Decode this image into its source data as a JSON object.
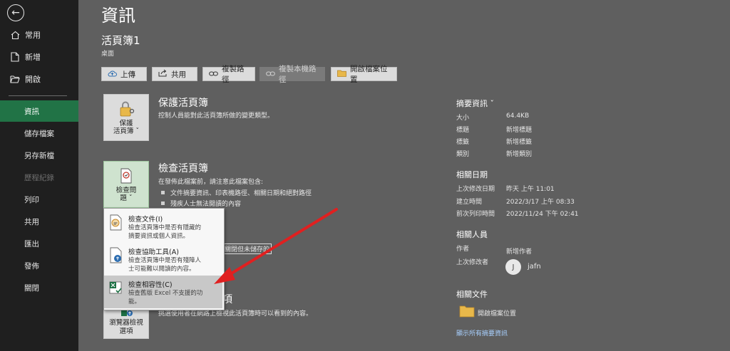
{
  "sidebar": {
    "back_icon": "back-arrow-icon",
    "top_items": [
      {
        "label": "常用",
        "icon": "home-icon"
      },
      {
        "label": "新增",
        "icon": "new-document-icon"
      },
      {
        "label": "開啟",
        "icon": "open-folder-icon"
      }
    ],
    "items": [
      {
        "label": "資訊"
      },
      {
        "label": "儲存檔案"
      },
      {
        "label": "另存新檔"
      },
      {
        "label": "歷程紀錄"
      },
      {
        "label": "列印"
      },
      {
        "label": "共用"
      },
      {
        "label": "匯出"
      },
      {
        "label": "發佈"
      },
      {
        "label": "關閉"
      }
    ]
  },
  "main": {
    "title": "資訊",
    "doc_name": "活頁簿1",
    "doc_location": "桌面",
    "toolbar": {
      "upload": "上傳",
      "share": "共用",
      "copy_path": "複製路徑",
      "copy_local_path": "複製本機路徑",
      "open_location": "開啟檔案位置"
    },
    "protect": {
      "tile_line1": "保護",
      "tile_line2": "活頁簿 ˇ",
      "title": "保護活頁簿",
      "desc": "控制人員能對此活頁簿所做的變更類型。"
    },
    "inspect": {
      "tile_line1": "檢查問",
      "tile_line2": "題 ˇ",
      "title": "檢查活頁簿",
      "desc": "在發佈此檔案前，請注意此檔案包含:",
      "bullets": [
        "文件摘要資訊、印表機路徑、相關日期和絕對路徑",
        "殘疾人士無法閱讀的內容"
      ],
      "partial_text": "關閉但未儲存的"
    },
    "browser": {
      "title_tail": "項",
      "tile_line1": "瀏覽器檢視",
      "tile_line2": "選項",
      "desc": "挑選使用者在網路上檢視此活頁簿時可以看到的內容。"
    },
    "dropdown": [
      {
        "head": "檢查文件(I)",
        "sub1": "檢查活頁簿中是否有隱藏的",
        "sub2": "摘要資訊或個人資訊。"
      },
      {
        "head": "檢查協助工具(A)",
        "sub1": "檢查活頁簿中是否有殘障人",
        "sub2": "士可能難以閱讀的內容。"
      },
      {
        "head": "檢查相容性(C)",
        "sub1": "檢查舊版 Excel 不支援的功",
        "sub2": "能。"
      }
    ]
  },
  "right": {
    "properties_title": "摘要資訊 ˇ",
    "properties": [
      {
        "k": "大小",
        "v": "64.4KB"
      },
      {
        "k": "標題",
        "v": "新增標題"
      },
      {
        "k": "標籤",
        "v": "新增標籤"
      },
      {
        "k": "類別",
        "v": "新增類別"
      }
    ],
    "dates_title": "相關日期",
    "dates": [
      {
        "k": "上次修改日期",
        "v": "昨天 上午 11:01"
      },
      {
        "k": "建立時間",
        "v": "2022/3/17 上午 08:33"
      },
      {
        "k": "前次列印時間",
        "v": "2022/11/24 下午 02:41"
      }
    ],
    "people_title": "相關人員",
    "author_k": "作者",
    "author_v": "新增作者",
    "modified_by_k": "上次修改者",
    "avatar_initial": "J",
    "modified_by_v": "jafn",
    "docs_title": "相關文件",
    "open_location": "開啟檔案位置",
    "show_all": "顯示所有摘要資訊"
  },
  "colors": {
    "sidebar_bg": "#1f1f1f",
    "active_green": "#217346",
    "main_bg": "#5f5f5f",
    "annotation_arrow": "#e02020"
  }
}
